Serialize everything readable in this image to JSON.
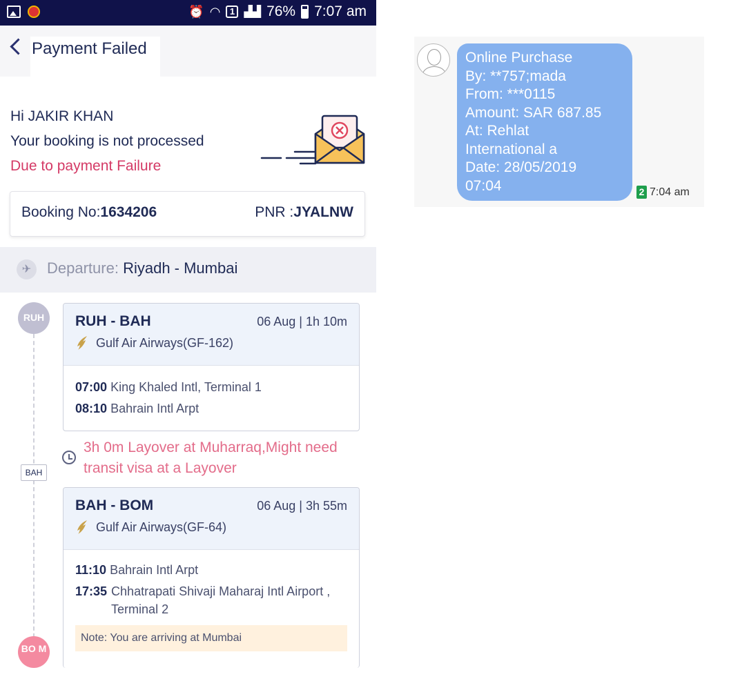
{
  "status_bar": {
    "battery": "76%",
    "time": "7:07 am",
    "sim_label": "1"
  },
  "header": {
    "title": "Payment Failed"
  },
  "greeting": {
    "hello": "Hi JAKIR KHAN",
    "message": "Your booking is not processed",
    "reason": "Due to payment Failure"
  },
  "booking": {
    "booking_label": "Booking No:",
    "booking_no": "1634206",
    "pnr_label": "PNR :",
    "pnr": "JYALNW"
  },
  "departure": {
    "label": "Departure:",
    "route": "Riyadh - Mumbai"
  },
  "timeline": {
    "start_code": "RUH",
    "stop_code": "BAH",
    "end_code": "BO M"
  },
  "legs": [
    {
      "route": "RUH - BAH",
      "date": "06 Aug | 1h 10m",
      "airline": "Gulf Air Airways(GF-162)",
      "dep_time": "07:00",
      "dep_place": "King Khaled Intl, Terminal 1",
      "arr_time": "08:10",
      "arr_place": "Bahrain Intl Arpt"
    },
    {
      "route": "BAH - BOM",
      "date": "06 Aug | 3h 55m",
      "airline": "Gulf Air Airways(GF-64)",
      "dep_time": "11:10",
      "dep_place": "Bahrain Intl Arpt",
      "arr_time": "17:35",
      "arr_place": "Chhatrapati Shivaji Maharaj Intl Airport , Terminal 2",
      "note": "Note: You are arriving at Mumbai"
    }
  ],
  "layover": {
    "text": "3h 0m Layover at Muharraq,Might need transit visa at a Layover"
  },
  "sms": {
    "lines": [
      "Online Purchase",
      "By: **757;mada",
      "From: ***0115",
      "Amount: SAR 687.85",
      "At: Rehlat",
      "International a",
      "Date: 28/05/2019",
      "07:04"
    ],
    "sim": "2",
    "time": "7:04 am",
    "bubble_color": "#85b1ee"
  },
  "colors": {
    "status_bar": "#10124a",
    "accent_pink": "#d43a66",
    "layover_pink": "#e36c8a",
    "navy": "#1f2a55"
  }
}
